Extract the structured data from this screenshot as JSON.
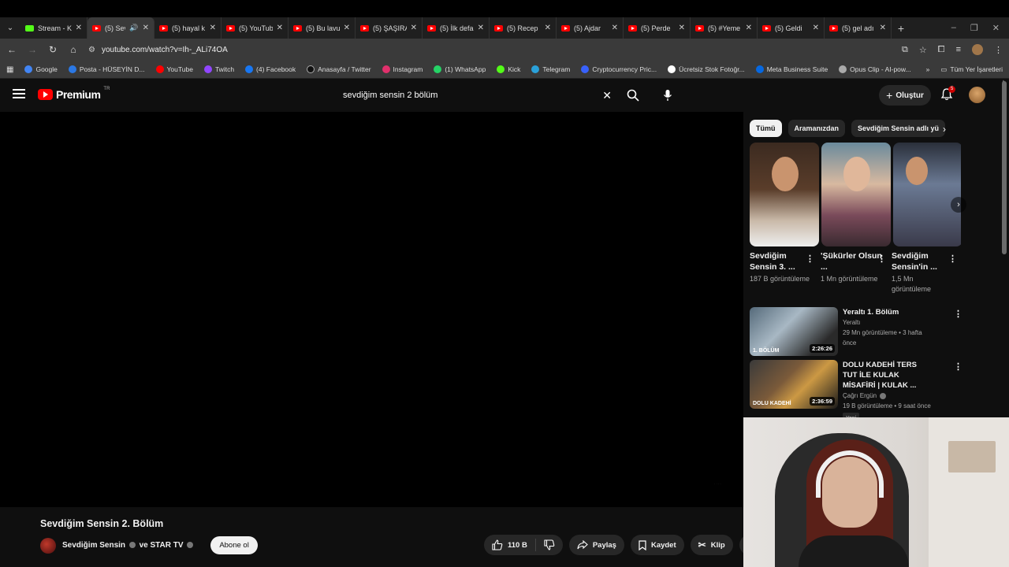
{
  "browser": {
    "tabs": [
      {
        "title": "Stream - K",
        "favicon": "kick-icon",
        "active": false
      },
      {
        "title": "(5) Sev",
        "favicon": "youtube-icon",
        "active": true,
        "audio": true
      },
      {
        "title": "(5) hayal k",
        "favicon": "youtube-icon"
      },
      {
        "title": "(5) YouTub",
        "favicon": "youtube-icon"
      },
      {
        "title": "(5) Bu lavu",
        "favicon": "youtube-icon"
      },
      {
        "title": "(5) ŞAŞIRA",
        "favicon": "youtube-icon"
      },
      {
        "title": "(5) İlk defa",
        "favicon": "youtube-icon"
      },
      {
        "title": "(5) Recep",
        "favicon": "youtube-icon"
      },
      {
        "title": "(5) Ajdar",
        "favicon": "youtube-icon"
      },
      {
        "title": "(5) Perde",
        "favicon": "youtube-icon"
      },
      {
        "title": "(5) #Yeme",
        "favicon": "youtube-icon"
      },
      {
        "title": "(5) Geldi",
        "favicon": "youtube-icon"
      },
      {
        "title": "(5) gel adı",
        "favicon": "youtube-icon"
      }
    ],
    "url": "youtube.com/watch?v=Ih-_ALi74OA",
    "bookmarks": [
      {
        "label": "Google",
        "color": "#4285f4"
      },
      {
        "label": "Posta - HÜSEYİN D...",
        "color": "#2b78e4"
      },
      {
        "label": "YouTube",
        "color": "#ff0000"
      },
      {
        "label": "Twitch",
        "color": "#9146ff"
      },
      {
        "label": "(4) Facebook",
        "color": "#1877f2"
      },
      {
        "label": "Anasayfa / Twitter",
        "color": "#000000"
      },
      {
        "label": "Instagram",
        "color": "#e1306c"
      },
      {
        "label": "(1) WhatsApp",
        "color": "#25d366"
      },
      {
        "label": "Kick",
        "color": "#53fc18"
      },
      {
        "label": "Telegram",
        "color": "#2aa1da"
      },
      {
        "label": "Cryptocurrency Pric...",
        "color": "#3861fb"
      },
      {
        "label": "Ücretsiz Stok Fotoğr...",
        "color": "#ffffff"
      },
      {
        "label": "Meta Business Suite",
        "color": "#0668e1"
      },
      {
        "label": "Opus Clip - AI-pow...",
        "color": "#aaaaaa"
      }
    ],
    "all_bookmarks": "Tüm Yer İşaretleri"
  },
  "youtube": {
    "logo_text": "Premium",
    "logo_region": "TR",
    "search_value": "sevdiğim sensin 2 bölüm",
    "create_label": "Oluştur",
    "notification_count": "5"
  },
  "video": {
    "title": "Sevdiğim Sensin 2. Bölüm",
    "channel_part1": "Sevdiğim Sensin",
    "channel_part2": "ve STAR TV",
    "subscribe_label": "Abone ol",
    "likes": "110 B",
    "share_label": "Paylaş",
    "save_label": "Kaydet",
    "clip_label": "Klip"
  },
  "sidebar": {
    "chips": [
      "Tümü",
      "Aramanızdan",
      "Sevdiğim Sensin adlı yü"
    ],
    "shorts": [
      {
        "title": "Sevdiğim Sensin 3. ...",
        "views": "187 B görüntüleme"
      },
      {
        "title": "'Şükürler Olsun ...",
        "views": "1 Mn görüntüleme"
      },
      {
        "title": "Sevdiğim Sensin'in ...",
        "views": "1,5 Mn görüntüleme"
      }
    ],
    "recommendations": [
      {
        "title": "Yeraltı 1. Bölüm",
        "channel": "Yeraltı",
        "meta": "29 Mn görüntüleme • 3 hafta önce",
        "duration": "2:26:26",
        "thumb_text": "1. BÖLÜM"
      },
      {
        "title": "DOLU KADEHİ TERS TUT İLE KULAK MİSAFİRİ | KULAK ...",
        "channel": "Çağrı Ergün",
        "meta": "19 B görüntüleme • 9 saat önce",
        "duration": "2:36:59",
        "badge": "Yeni",
        "thumb_text": "DOLU KADEHİ"
      }
    ]
  }
}
